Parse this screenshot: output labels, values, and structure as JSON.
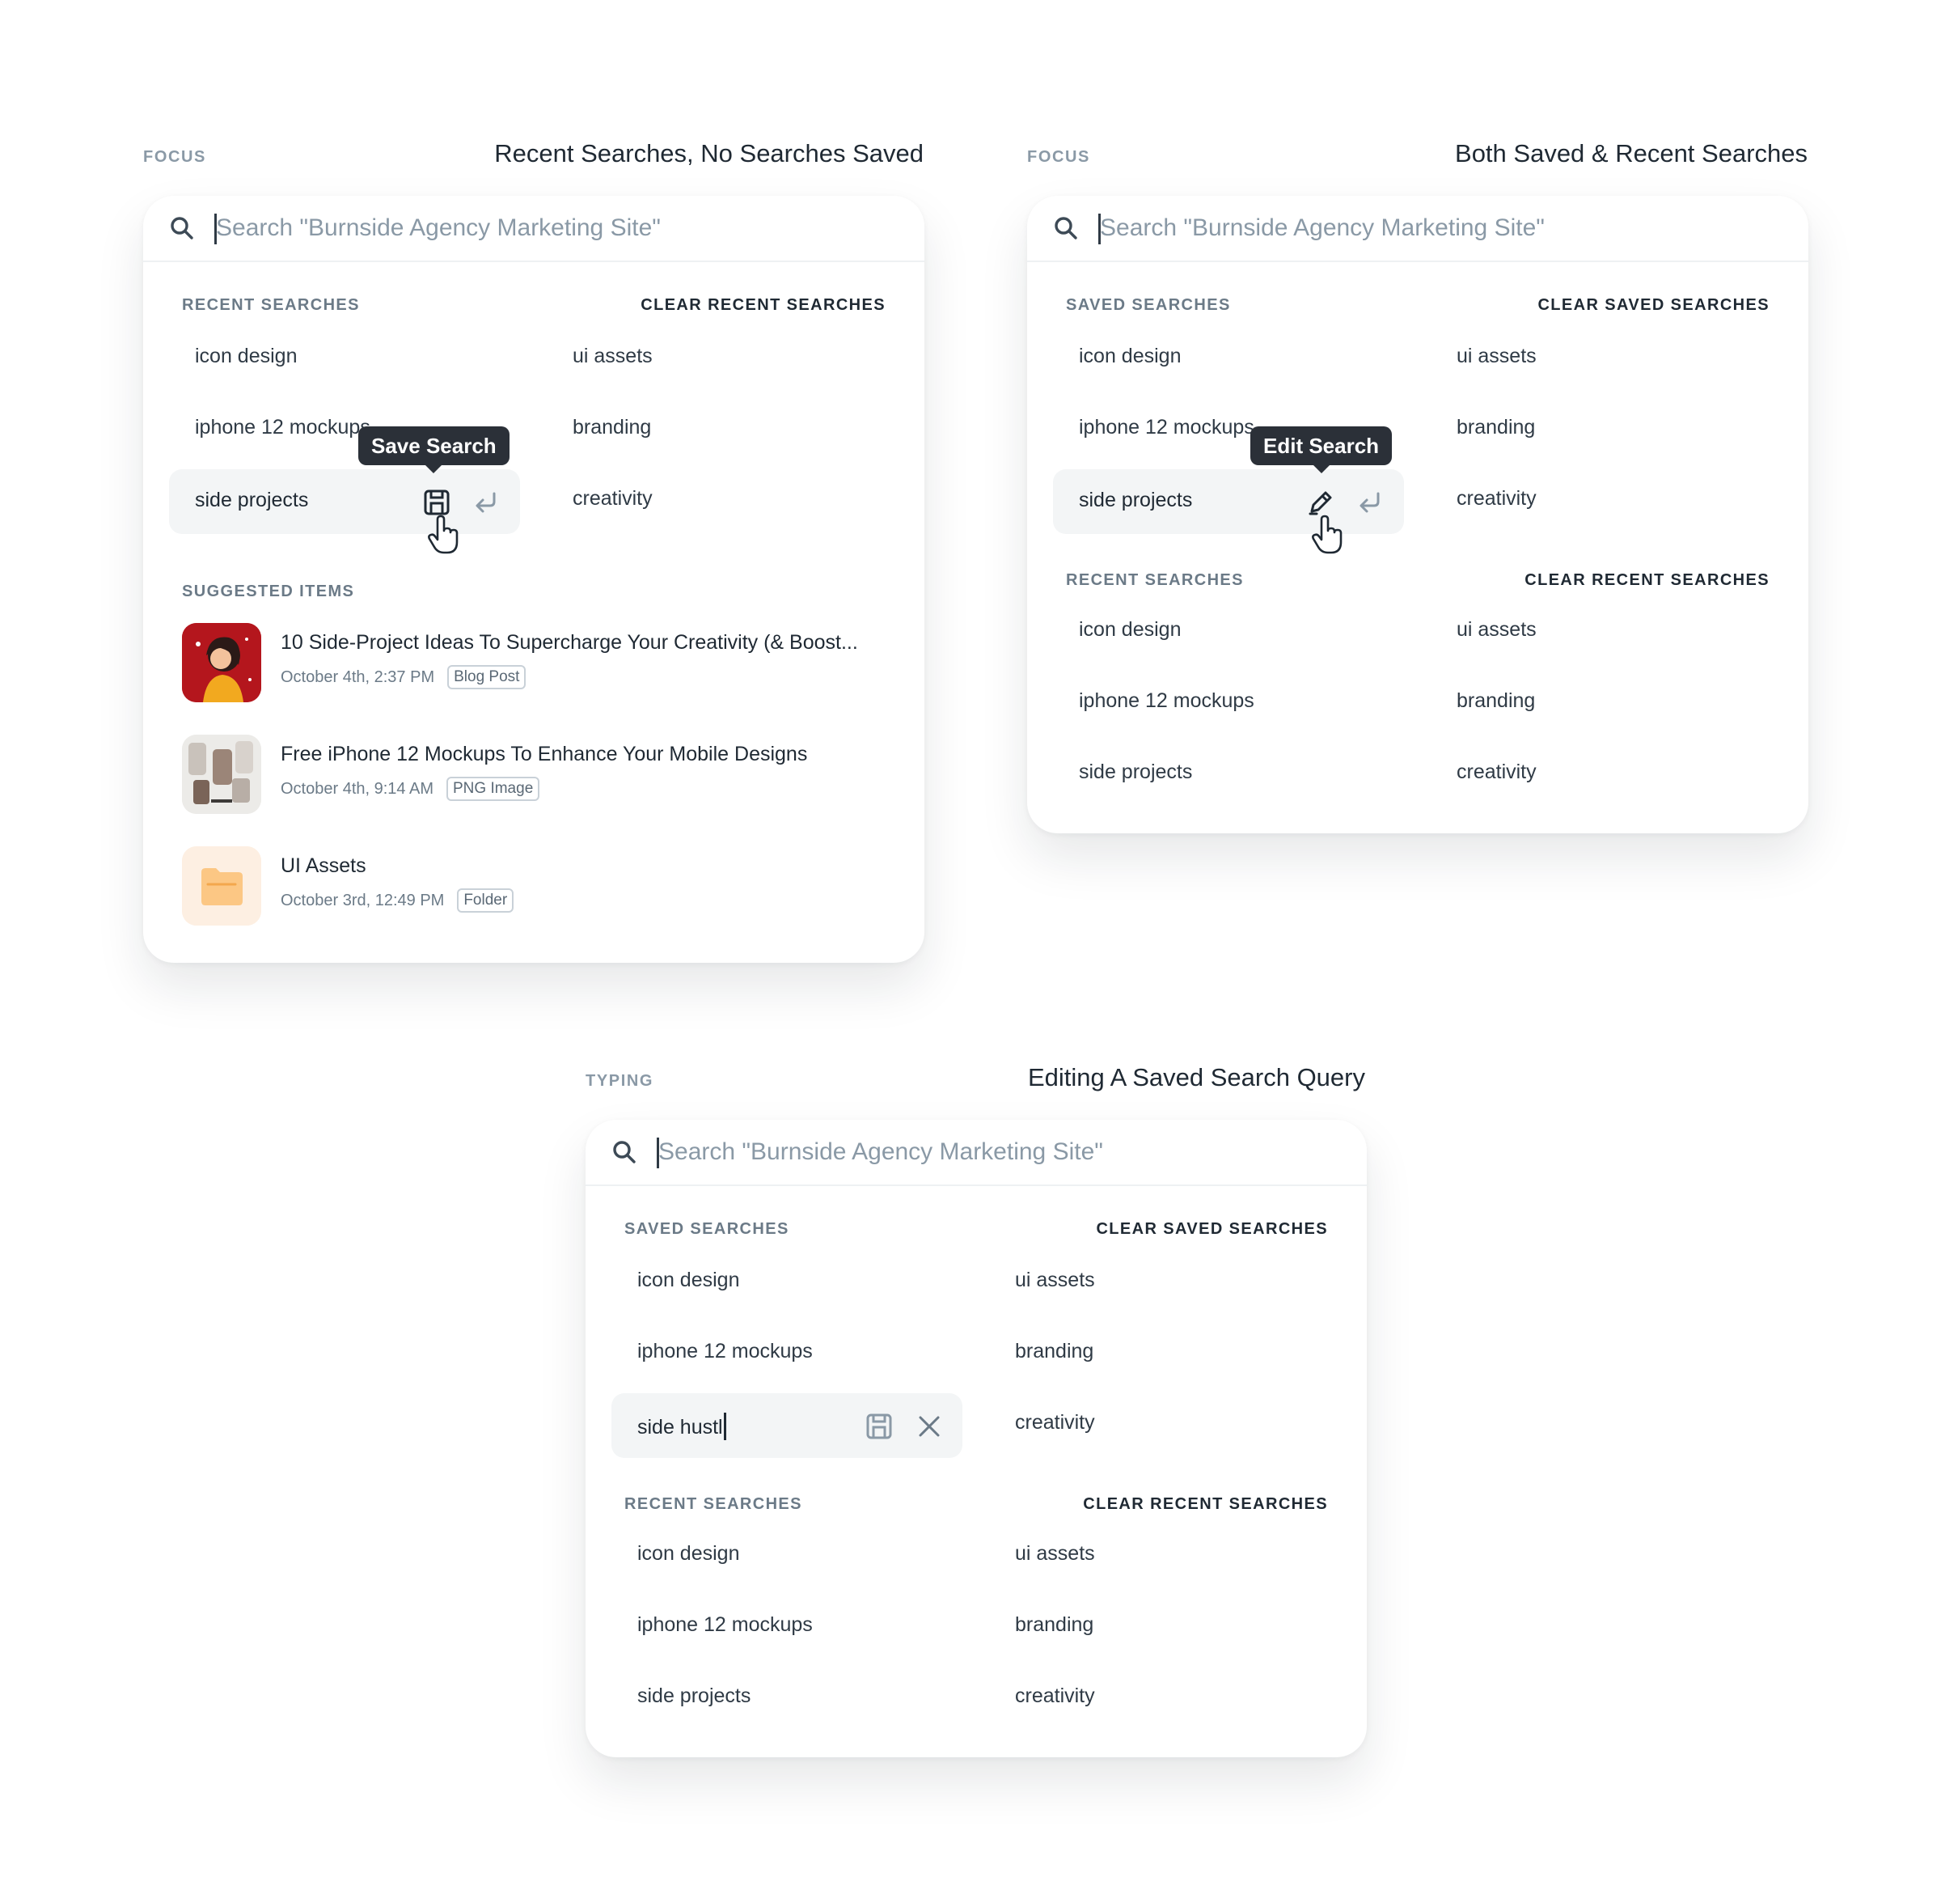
{
  "placeholder": "Search \"Burnside Agency Marketing Site\"",
  "panel1": {
    "state": "FOCUS",
    "title": "Recent Searches, No Searches Saved",
    "recent_title": "RECENT SEARCHES",
    "recent_clear": "CLEAR RECENT SEARCHES",
    "recent": [
      "icon design",
      "ui assets",
      "iphone 12 mockups",
      "branding",
      "side projects",
      "creativity"
    ],
    "tooltip": "Save Search",
    "suggested_title": "SUGGESTED ITEMS",
    "suggested": [
      {
        "title": "10 Side-Project Ideas To Supercharge Your Creativity (& Boost...",
        "date": "October 4th, 2:37 PM",
        "tag": "Blog Post"
      },
      {
        "title": "Free iPhone 12 Mockups To Enhance Your Mobile Designs",
        "date": "October 4th, 9:14 AM",
        "tag": "PNG Image"
      },
      {
        "title": "UI Assets",
        "date": "October 3rd, 12:49 PM",
        "tag": "Folder"
      }
    ]
  },
  "panel2": {
    "state": "FOCUS",
    "title": "Both Saved & Recent Searches",
    "saved_title": "SAVED SEARCHES",
    "saved_clear": "CLEAR SAVED SEARCHES",
    "saved": [
      "icon design",
      "ui assets",
      "iphone 12 mockups",
      "branding",
      "side projects",
      "creativity"
    ],
    "tooltip": "Edit Search",
    "recent_title": "RECENT SEARCHES",
    "recent_clear": "CLEAR RECENT SEARCHES",
    "recent": [
      "icon design",
      "ui assets",
      "iphone 12 mockups",
      "branding",
      "side projects",
      "creativity"
    ]
  },
  "panel3": {
    "state": "TYPING",
    "title": "Editing A Saved Search Query",
    "saved_title": "SAVED SEARCHES",
    "saved_clear": "CLEAR SAVED SEARCHES",
    "saved": [
      "icon design",
      "ui assets",
      "iphone 12 mockups",
      "branding",
      "side hustl",
      "creativity"
    ],
    "recent_title": "RECENT SEARCHES",
    "recent_clear": "CLEAR RECENT SEARCHES",
    "recent": [
      "icon design",
      "ui assets",
      "iphone 12 mockups",
      "branding",
      "side projects",
      "creativity"
    ]
  },
  "colors": {
    "accent": "#1f2933",
    "muted": "#8a99a6",
    "highlight": "#f3f5f6",
    "tooltip": "#2b3038"
  }
}
